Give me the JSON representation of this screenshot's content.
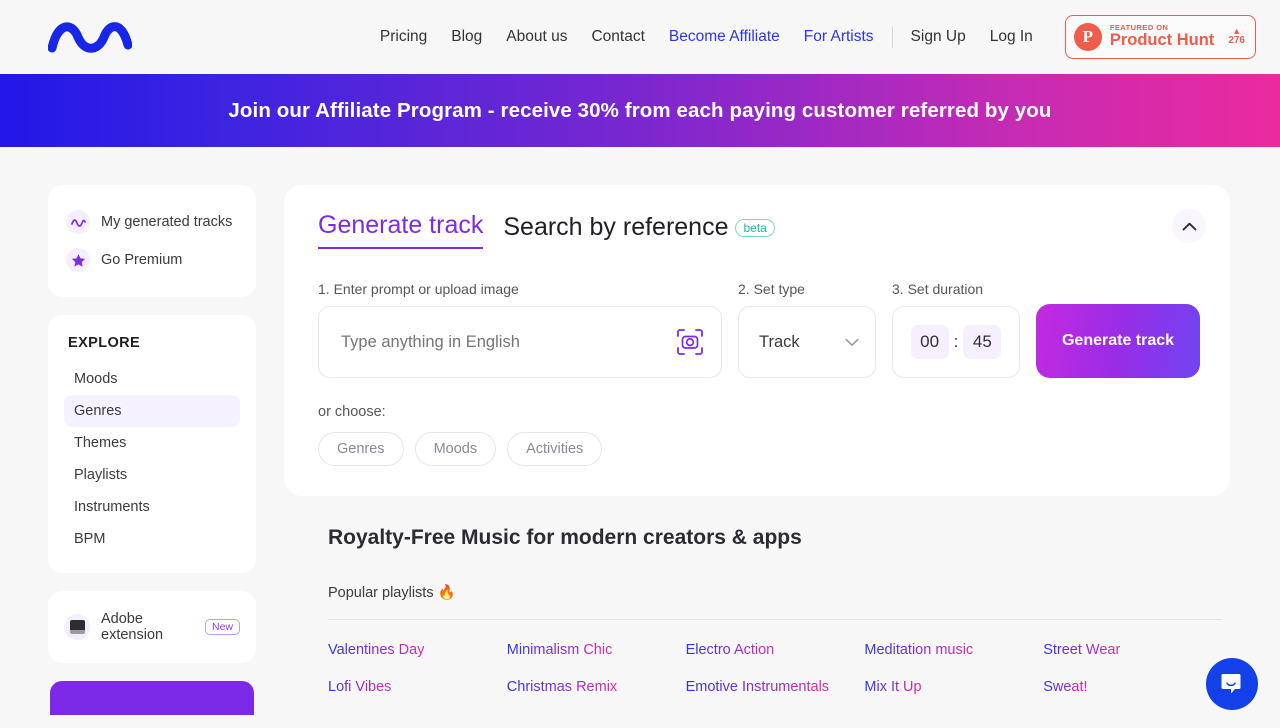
{
  "header": {
    "logo_icon": "wave-logo",
    "nav": [
      {
        "label": "Pricing",
        "accent": false
      },
      {
        "label": "Blog",
        "accent": false
      },
      {
        "label": "About us",
        "accent": false
      },
      {
        "label": "Contact",
        "accent": false
      },
      {
        "label": "Become Affiliate",
        "accent": true
      },
      {
        "label": "For Artists",
        "accent": true
      }
    ],
    "auth": [
      {
        "label": "Sign Up"
      },
      {
        "label": "Log In"
      }
    ],
    "product_hunt": {
      "mark": "P",
      "featured_label": "FEATURED ON",
      "name": "Product Hunt",
      "arrow": "▲",
      "count": "276",
      "color": "#ef5c4b"
    }
  },
  "banner": {
    "text": "Join our Affiliate Program - receive 30% from each paying customer referred by you",
    "gradient_from": "#2217e8",
    "gradient_to": "#ec2a9e"
  },
  "sidebar": {
    "top_items": [
      {
        "label": "My generated tracks",
        "icon": "wave-icon"
      },
      {
        "label": "Go Premium",
        "icon": "star-icon"
      }
    ],
    "explore_title": "EXPLORE",
    "explore_items": [
      {
        "label": "Moods",
        "active": false
      },
      {
        "label": "Genres",
        "active": true
      },
      {
        "label": "Themes",
        "active": false
      },
      {
        "label": "Playlists",
        "active": false
      },
      {
        "label": "Instruments",
        "active": false
      },
      {
        "label": "BPM",
        "active": false
      }
    ],
    "adobe": {
      "label": "Adobe extension",
      "badge": "New"
    }
  },
  "generator": {
    "tabs": [
      {
        "label": "Generate track",
        "active": true
      },
      {
        "label": "Search by reference",
        "active": false,
        "badge": "beta"
      }
    ],
    "collapse_icon": "chevron-up-icon",
    "prompt": {
      "label": "1. Enter prompt or upload image",
      "placeholder": "Type anything in English",
      "value": "",
      "upload_icon": "camera-scan-icon"
    },
    "type": {
      "label": "2. Set type",
      "value": "Track",
      "chevron": "chevron-down-icon"
    },
    "duration": {
      "label": "3. Set duration",
      "minutes": "00",
      "separator": ":",
      "seconds": "45"
    },
    "generate_button": "Generate track",
    "or_choose_label": "or choose:",
    "chips": [
      "Genres",
      "Moods",
      "Activities"
    ]
  },
  "content": {
    "seo_title": "Royalty-Free Music for modern creators & apps",
    "popular_label": "Popular playlists 🔥",
    "playlists": [
      "Valentines Day",
      "Minimalism Chic",
      "Electro Action",
      "Meditation music",
      "Street Wear",
      "Lofi Vibes",
      "Christmas Remix",
      "Emotive Instrumentals",
      "Mix It Up",
      "Sweat!"
    ]
  },
  "intercom": {
    "icon": "chat-bubble-icon",
    "color": "#1340e8"
  }
}
